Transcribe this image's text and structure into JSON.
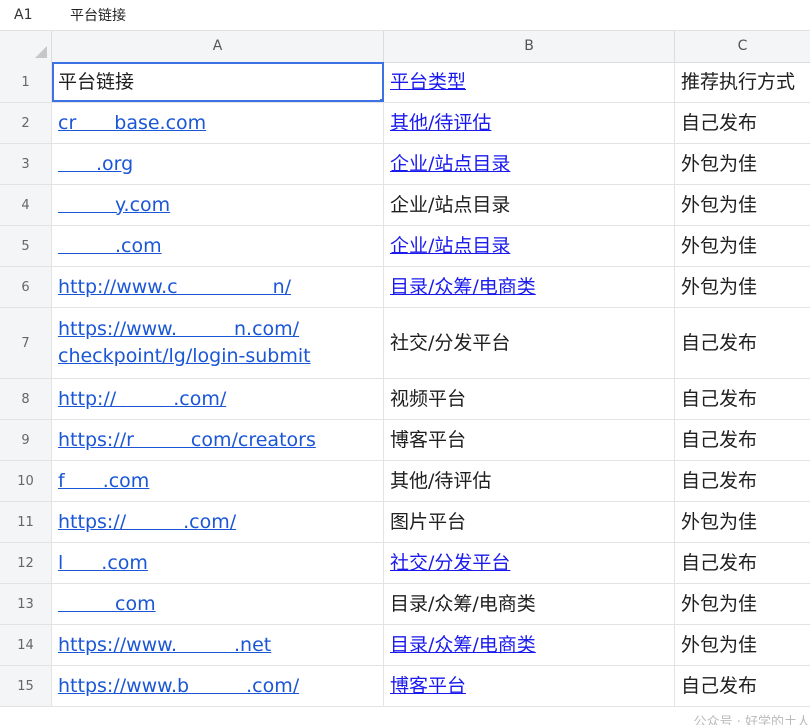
{
  "formula_bar": {
    "cell_ref": "A1",
    "value": "平台链接"
  },
  "columns": [
    "A",
    "B",
    "C"
  ],
  "rows": [
    {
      "n": "1",
      "a": "平台链接",
      "a_link": false,
      "b": "平台类型",
      "b_link": true,
      "c": "推荐执行方式"
    },
    {
      "n": "2",
      "a": "cr  base.com",
      "a_link": true,
      "b": "其他/待评估",
      "b_link": true,
      "c": "自己发布"
    },
    {
      "n": "3",
      "a": "  .org",
      "a_link": true,
      "b": "企业/站点目录",
      "b_link": true,
      "c": "外包为佳"
    },
    {
      "n": "4",
      "a": "   y.com",
      "a_link": true,
      "b": "企业/站点目录",
      "b_link": false,
      "c": "外包为佳"
    },
    {
      "n": "5",
      "a": "   .com",
      "a_link": true,
      "b": "企业/站点目录",
      "b_link": true,
      "c": "外包为佳"
    },
    {
      "n": "6",
      "a": "http://www.c     n/",
      "a_link": true,
      "b": "目录/众筹/电商类",
      "b_link": true,
      "c": "外包为佳"
    },
    {
      "n": "7",
      "a": "https://www.   n.com/\ncheckpoint/lg/login-submit",
      "a_link": true,
      "b": "社交/分发平台",
      "b_link": false,
      "c": "自己发布"
    },
    {
      "n": "8",
      "a": "http://   .com/",
      "a_link": true,
      "b": "视频平台",
      "b_link": false,
      "c": "自己发布"
    },
    {
      "n": "9",
      "a": "https://r   com/creators",
      "a_link": true,
      "b": "博客平台",
      "b_link": false,
      "c": "自己发布"
    },
    {
      "n": "10",
      "a": "f  .com",
      "a_link": true,
      "b": "其他/待评估",
      "b_link": false,
      "c": "自己发布"
    },
    {
      "n": "11",
      "a": "https://   .com/",
      "a_link": true,
      "b": "图片平台",
      "b_link": false,
      "c": "外包为佳"
    },
    {
      "n": "12",
      "a": "l  .com",
      "a_link": true,
      "b": "社交/分发平台",
      "b_link": true,
      "c": "自己发布"
    },
    {
      "n": "13",
      "a": "   com",
      "a_link": true,
      "b": "目录/众筹/电商类",
      "b_link": false,
      "c": "外包为佳"
    },
    {
      "n": "14",
      "a": "https://www.   .net",
      "a_link": true,
      "b": "目录/众筹/电商类",
      "b_link": true,
      "c": "外包为佳"
    },
    {
      "n": "15",
      "a": "https://www.b   .com/",
      "a_link": true,
      "b": "博客平台",
      "b_link": true,
      "c": "自己发布"
    }
  ],
  "watermark": "公众号 · 好学的土人"
}
